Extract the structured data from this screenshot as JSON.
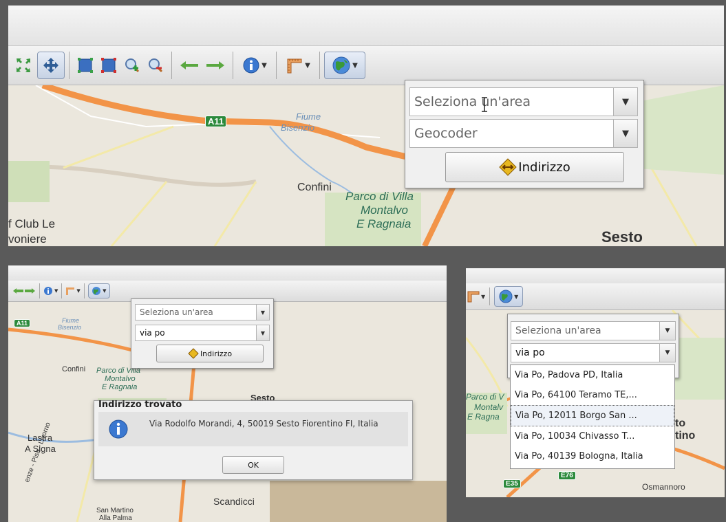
{
  "colors": {
    "background": "#5a5a5a",
    "highway": "#f29448",
    "map_bg": "#ebe7dd",
    "green": "#cfdfb8"
  },
  "toolbar": {
    "icons": [
      "zoom-extent-icon",
      "pan-icon",
      "zoom-box-in-icon",
      "zoom-box-out-icon",
      "zoom-in-icon",
      "zoom-out-icon",
      "history-back-icon",
      "history-forward-icon",
      "info-icon",
      "measure-icon",
      "geocoder-globe-icon"
    ]
  },
  "panel1": {
    "area_placeholder": "Seleziona un'area",
    "geocoder_placeholder": "Geocoder",
    "address_button": "Indirizzo",
    "labels": {
      "a11": "A11",
      "fiume": "Fiume",
      "bisenzio": "Bisenzio",
      "confini": "Confini",
      "parco1": "Parco di Villa",
      "parco2": "Montalvo",
      "parco3": "E Ragnaia",
      "golf1": "f Club Le",
      "golf2": "voniere",
      "sesto": "Sesto"
    }
  },
  "panel2": {
    "area_placeholder": "Seleziona un'area",
    "geocoder_value": "via po",
    "address_button": "Indirizzo",
    "dialog_title": "Indirizzo trovato",
    "dialog_message": "Via Rodolfo Morandi, 4, 50019 Sesto Fiorentino FI, Italia",
    "ok_button": "OK",
    "labels": {
      "a11": "A11",
      "fiume": "Fiume",
      "bisenzio": "Bisenzio",
      "confini": "Confini",
      "parco1": "Parco di Villa",
      "parco2": "Montalvo",
      "parco3": "E Ragnaia",
      "sesto": "Sesto",
      "lastra1": "Lastra",
      "lastra2": "A Signa",
      "road_vert": "enze - Pisa - Livorno",
      "scandicci": "Scandicci",
      "sanmartino1": "San Martino",
      "sanmartino2": "Alla Palma"
    }
  },
  "panel3": {
    "area_placeholder": "Seleziona un'area",
    "geocoder_value": "via po",
    "results": [
      "Via Po, Padova PD, Italia",
      "Via Po, 64100 Teramo TE,...",
      "Via Po, 12011 Borgo San ...",
      "Via Po, 10034 Chivasso T...",
      "Via Po, 40139 Bologna, Italia"
    ],
    "labels": {
      "parco1": "Parco di V",
      "parco2": "Montalv",
      "parco3": "E Ragna",
      "to": "to",
      "tino": "tino",
      "e35": "E35",
      "e76": "E76",
      "osmannoro": "Osmannoro"
    }
  }
}
